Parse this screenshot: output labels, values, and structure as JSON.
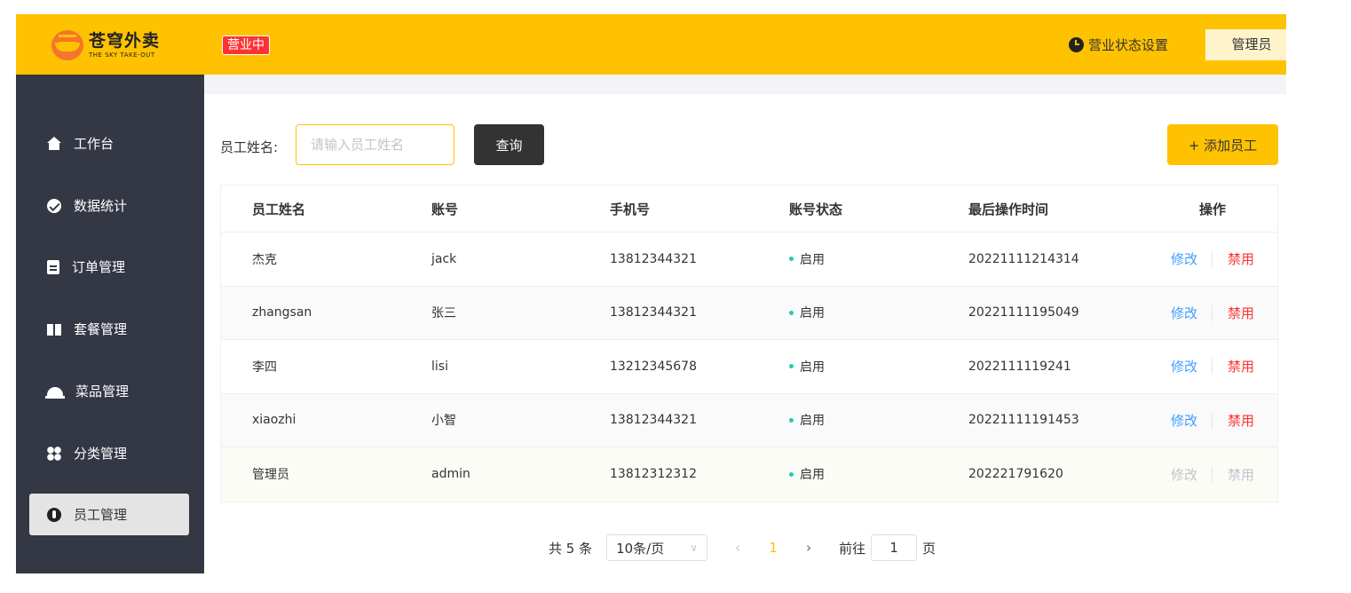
{
  "header": {
    "logo_cn": "苍穹外卖",
    "logo_en": "THE SKY TAKE-OUT",
    "status_tag": "营业中",
    "status_setting": "营业状态设置",
    "user": "管理员"
  },
  "sidebar": {
    "items": [
      {
        "label": "工作台",
        "icon": "home-icon"
      },
      {
        "label": "数据统计",
        "icon": "chart-icon"
      },
      {
        "label": "订单管理",
        "icon": "clipboard-icon"
      },
      {
        "label": "套餐管理",
        "icon": "gift-icon"
      },
      {
        "label": "菜品管理",
        "icon": "cloche-icon"
      },
      {
        "label": "分类管理",
        "icon": "grid-icon"
      },
      {
        "label": "员工管理",
        "icon": "user-icon",
        "active": true
      }
    ]
  },
  "search": {
    "label": "员工姓名:",
    "placeholder": "请输入员工姓名",
    "query_btn": "查询",
    "add_btn": "+ 添加员工"
  },
  "table": {
    "columns": [
      "员工姓名",
      "账号",
      "手机号",
      "账号状态",
      "最后操作时间",
      "操作"
    ],
    "rows": [
      {
        "name": "杰克",
        "account": "jack",
        "phone": "13812344321",
        "status": "启用",
        "time": "20221111214314",
        "edit": "修改",
        "disable": "禁用"
      },
      {
        "name": "zhangsan",
        "account": "张三",
        "phone": "13812344321",
        "status": "启用",
        "time": "20221111195049",
        "edit": "修改",
        "disable": "禁用"
      },
      {
        "name": "李四",
        "account": "lisi",
        "phone": "13212345678",
        "status": "启用",
        "time": "2022111119241",
        "edit": "修改",
        "disable": "禁用"
      },
      {
        "name": "xiaozhi",
        "account": "小智",
        "phone": "13812344321",
        "status": "启用",
        "time": "20221111191453",
        "edit": "修改",
        "disable": "禁用"
      },
      {
        "name": "管理员",
        "account": "admin",
        "phone": "13812312312",
        "status": "启用",
        "time": "202221791620",
        "edit": "修改",
        "disable": "禁用"
      }
    ]
  },
  "pagination": {
    "total": "共 5 条",
    "page_size": "10条/页",
    "current": "1",
    "goto_label": "前往",
    "goto_value": "1",
    "page_unit": "页"
  },
  "colors": {
    "accent": "#ffc200",
    "sidebar": "#343744",
    "edit": "#419eff",
    "disable": "#fd3333",
    "status_dot": "#22ccb2"
  }
}
